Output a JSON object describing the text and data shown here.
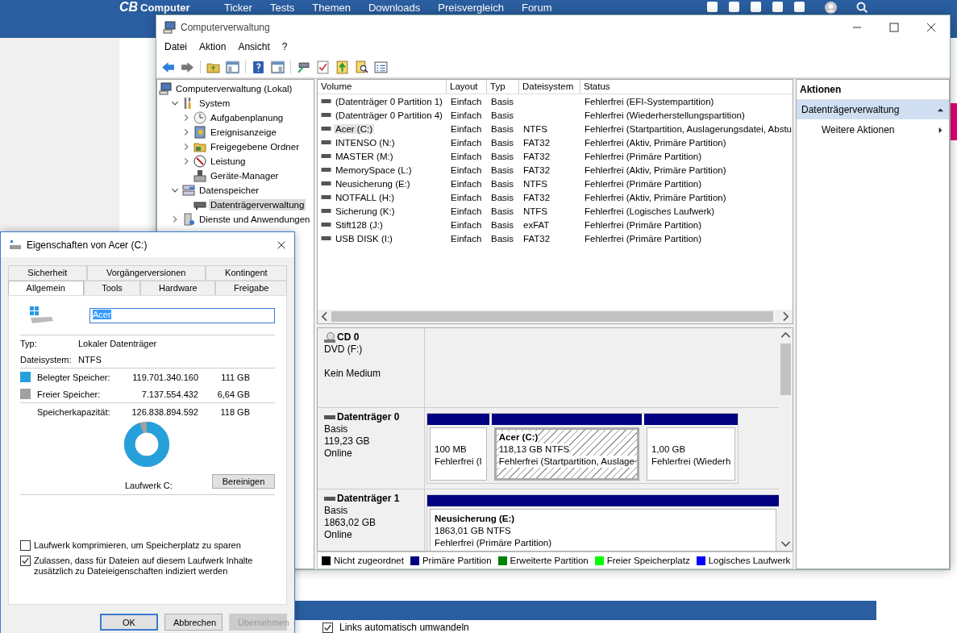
{
  "website": {
    "logo": {
      "initials": "CB",
      "word": "Computer"
    },
    "nav": [
      "Ticker",
      "Tests",
      "Themen",
      "Downloads",
      "Preisvergleich",
      "Forum"
    ],
    "option": {
      "label": "Links automatisch umwandeln",
      "checked": true
    }
  },
  "window": {
    "title": "Computerverwaltung",
    "menu": [
      "Datei",
      "Aktion",
      "Ansicht",
      "?"
    ],
    "tree": [
      {
        "label": "Computerverwaltung (Lokal)",
        "selected": false,
        "children": [
          {
            "label": "System",
            "kind": "branch",
            "expanded": true,
            "selected": false,
            "children": [
              {
                "label": "Aufgabenplanung",
                "kind": "branch",
                "expanded": false,
                "selected": false
              },
              {
                "label": "Ereignisanzeige",
                "kind": "branch",
                "expanded": false,
                "selected": false
              },
              {
                "label": "Freigegebene Ordner",
                "kind": "branch",
                "expanded": false,
                "selected": false
              },
              {
                "label": "Leistung",
                "kind": "branch",
                "expanded": false,
                "selected": false
              },
              {
                "label": "Geräte-Manager",
                "kind": "leaf",
                "selected": false
              }
            ]
          },
          {
            "label": "Datenspeicher",
            "kind": "branch",
            "expanded": true,
            "selected": false,
            "children": [
              {
                "label": "Datenträgerverwaltung",
                "kind": "leaf",
                "selected": true
              }
            ]
          },
          {
            "label": "Dienste und Anwendungen",
            "kind": "branch",
            "expanded": false,
            "selected": false
          }
        ]
      }
    ],
    "table": {
      "columns": [
        "Volume",
        "Layout",
        "Typ",
        "Dateisystem",
        "Status"
      ],
      "rows": [
        {
          "cells": [
            "(Datenträger 0 Partition 1)",
            "Einfach",
            "Basis",
            "",
            "Fehlerfrei (EFI-Systempartition)"
          ],
          "selected": false
        },
        {
          "cells": [
            "(Datenträger 0 Partition 4)",
            "Einfach",
            "Basis",
            "",
            "Fehlerfrei (Wiederherstellungspartition)"
          ],
          "selected": false
        },
        {
          "cells": [
            "Acer (C:)",
            "Einfach",
            "Basis",
            "NTFS",
            "Fehlerfrei (Startpartition, Auslagerungsdatei, Abstu"
          ],
          "selected": true
        },
        {
          "cells": [
            "INTENSO (N:)",
            "Einfach",
            "Basis",
            "FAT32",
            "Fehlerfrei (Aktiv, Primäre Partition)"
          ],
          "selected": false
        },
        {
          "cells": [
            "MASTER (M:)",
            "Einfach",
            "Basis",
            "FAT32",
            "Fehlerfrei (Primäre Partition)"
          ],
          "selected": false
        },
        {
          "cells": [
            "MemorySpace (L:)",
            "Einfach",
            "Basis",
            "FAT32",
            "Fehlerfrei (Aktiv, Primäre Partition)"
          ],
          "selected": false
        },
        {
          "cells": [
            "Neusicherung (E:)",
            "Einfach",
            "Basis",
            "NTFS",
            "Fehlerfrei (Primäre Partition)"
          ],
          "selected": false
        },
        {
          "cells": [
            "NOTFALL (H:)",
            "Einfach",
            "Basis",
            "FAT32",
            "Fehlerfrei (Aktiv, Primäre Partition)"
          ],
          "selected": false
        },
        {
          "cells": [
            "Sicherung (K:)",
            "Einfach",
            "Basis",
            "NTFS",
            "Fehlerfrei (Logisches Laufwerk)"
          ],
          "selected": false
        },
        {
          "cells": [
            "Stift128 (J:)",
            "Einfach",
            "Basis",
            "exFAT",
            "Fehlerfrei (Primäre Partition)"
          ],
          "selected": false
        },
        {
          "cells": [
            "USB DISK (I:)",
            "Einfach",
            "Basis",
            "FAT32",
            "Fehlerfrei (Primäre Partition)"
          ],
          "selected": false
        }
      ]
    },
    "disks": [
      {
        "kind": "cdrom",
        "name": "CD 0",
        "lines": [
          "DVD (F:)",
          "Kein Medium"
        ]
      },
      {
        "kind": "disk",
        "name": "Datenträger 0",
        "lines": [
          "Basis",
          "119,23 GB",
          "Online"
        ],
        "partitions": [
          {
            "color": "#000080",
            "selected": false,
            "lines": [
              "100 MB",
              "Fehlerfrei (I"
            ]
          },
          {
            "color": "#000080",
            "selected": true,
            "title": "Acer  (C:)",
            "lines": [
              "118,13 GB NTFS",
              "Fehlerfrei (Startpartition, Auslage"
            ]
          },
          {
            "color": "#000080",
            "selected": false,
            "lines": [
              "1,00 GB",
              "Fehlerfrei (Wiederh"
            ]
          }
        ]
      },
      {
        "kind": "disk",
        "name": "Datenträger 1",
        "lines": [
          "Basis",
          "1863,02 GB",
          "Online"
        ],
        "partitions": [
          {
            "color": "#000080",
            "selected": false,
            "title": "Neusicherung  (E:)",
            "lines": [
              "1863,01 GB NTFS",
              "Fehlerfrei (Primäre Partition)"
            ]
          }
        ]
      }
    ],
    "legend": [
      {
        "label": "Nicht zugeordnet",
        "color": "#000000"
      },
      {
        "label": "Primäre Partition",
        "color": "#000080"
      },
      {
        "label": "Erweiterte Partition",
        "color": "#008000"
      },
      {
        "label": "Freier Speicherplatz",
        "color": "#00ff00"
      },
      {
        "label": "Logisches Laufwerk",
        "color": "#0000ff"
      }
    ],
    "actions": {
      "title": "Aktionen",
      "section": "Datenträgerverwaltung",
      "items": [
        "Weitere Aktionen"
      ]
    }
  },
  "dialog": {
    "title": "Eigenschaften von Acer (C:)",
    "tab_rows": [
      [
        {
          "label": "Sicherheit",
          "selected": false
        },
        {
          "label": "Vorgängerversionen",
          "selected": false
        },
        {
          "label": "Kontingent",
          "selected": false
        }
      ],
      [
        {
          "label": "Allgemein",
          "selected": true
        },
        {
          "label": "Tools",
          "selected": false
        },
        {
          "label": "Hardware",
          "selected": false
        },
        {
          "label": "Freigabe",
          "selected": false
        }
      ]
    ],
    "name_value": "Acer",
    "info": [
      {
        "label": "Typ:",
        "value": "Lokaler Datenträger"
      },
      {
        "label": "Dateisystem:",
        "value": "NTFS"
      }
    ],
    "space": [
      {
        "label": "Belegter Speicher:",
        "bytes": "119.701.340.160",
        "size": "111 GB",
        "color": "#26a0da"
      },
      {
        "label": "Freier Speicher:",
        "bytes": "7.137.554.432",
        "size": "6,64 GB",
        "color": "#a0a0a0"
      }
    ],
    "capacity": {
      "label": "Speicherkapazität:",
      "bytes": "126.838.894.592",
      "size": "118 GB"
    },
    "usage": {
      "level": 0.944
    },
    "drive_label": "Laufwerk C:",
    "cleanup": "Bereinigen",
    "options": [
      {
        "label": "Laufwerk komprimieren, um Speicherplatz zu sparen",
        "checked": false
      },
      {
        "label": "Zulassen, dass für Dateien auf diesem Laufwerk Inhalte zusätzlich zu Dateieigenschaften indiziert werden",
        "checked": true
      }
    ],
    "buttons": [
      {
        "label": "OK",
        "default": true,
        "disabled": false
      },
      {
        "label": "Abbrechen",
        "default": false,
        "disabled": false
      },
      {
        "label": "Übernehmen",
        "default": false,
        "disabled": true
      }
    ]
  }
}
